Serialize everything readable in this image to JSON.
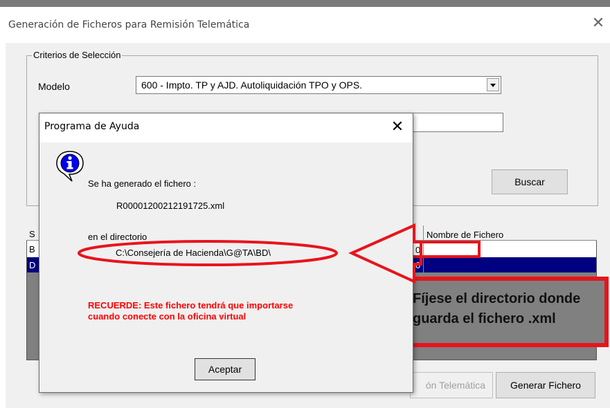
{
  "main_window": {
    "title": "Generación de Ficheros para Remisión Telemática",
    "close_glyph": "✕"
  },
  "criteria": {
    "legend": "Criterios de Selección",
    "modelo_label": "Modelo",
    "modelo_value": "600 - Impto. TP y AJD. Autoliquidación TPO y OPS.",
    "buscar_label": "Buscar"
  },
  "table": {
    "column_header": "Nombre de Fichero",
    "col1_snip": "S",
    "row1_snip": "B",
    "row2_snip": "D",
    "row1_cell": "0",
    "row2_cell": "0"
  },
  "bottom_buttons": {
    "telematica_label": "ón Telemática",
    "generar_label": "Generar Fichero"
  },
  "dialog": {
    "title": "Programa de Ayuda",
    "close_glyph": "✕",
    "icon": "info-icon",
    "line_generated": "Se ha generado el fichero :",
    "filename": "R00001200212191725.xml",
    "dir_label": "en el directorio",
    "dir_path": "C:\\Consejería de Hacienda\\G@TA\\BD\\",
    "warning_line1": "RECUERDE: Este fichero tendrá que importarse",
    "warning_line2": "cuando conecte con la oficina virtual",
    "accept_label": "Aceptar"
  },
  "annotation": {
    "line1": "Fíjese el directorio donde",
    "line2": "guarda el fichero .xml",
    "color": "#e8141c"
  },
  "colors": {
    "selection": "#000080",
    "window_bg": "#f0f0f0",
    "warning": "#ff0000"
  }
}
